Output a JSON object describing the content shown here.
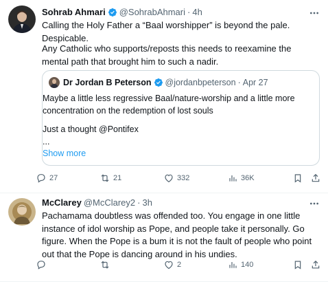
{
  "tweet1": {
    "display_name": "Sohrab Ahmari",
    "handle": "@SohrabAhmari",
    "separator": "·",
    "time": "4h",
    "text_line1": "Calling the Holy Father a “Baal worshipper” is beyond the pale. Despicable.",
    "text_line2": "Any Catholic who supports/reposts this needs to reexamine the mental path that brought him to such a nadir.",
    "quote": {
      "display_name": "Dr Jordan B Peterson",
      "handle": "@jordanbpeterson",
      "separator": "·",
      "time": "Apr 27",
      "text_line1": "Maybe a little less regressive Baal/nature-worship and a little more concentration on the redemption of lost souls",
      "text_line2": "Just a thought @Pontifex",
      "ellipsis": "...",
      "show_more": "Show more"
    },
    "actions": {
      "replies": "27",
      "reposts": "21",
      "likes": "332",
      "views": "36K"
    }
  },
  "tweet2": {
    "display_name": "McClarey",
    "handle": "@McClarey2",
    "separator": "·",
    "time": "3h",
    "text": "Pachamama doubtless was offended too.  You engage in one little instance of idol worship as Pope, and people take it personally.  Go figure.  When the Pope is a bum it is not the fault of people who point out that the Pope is dancing around in his undies.",
    "actions": {
      "replies": "",
      "reposts": "",
      "likes": "2",
      "views": "140"
    }
  },
  "colors": {
    "verified": "#1d9bf0",
    "secondary_text": "#536471",
    "link": "#1d9bf0",
    "border": "#cfd9de"
  },
  "icons": [
    "verified-badge-icon",
    "more-icon",
    "reply-icon",
    "repost-icon",
    "like-icon",
    "views-icon",
    "bookmark-icon",
    "share-icon"
  ]
}
